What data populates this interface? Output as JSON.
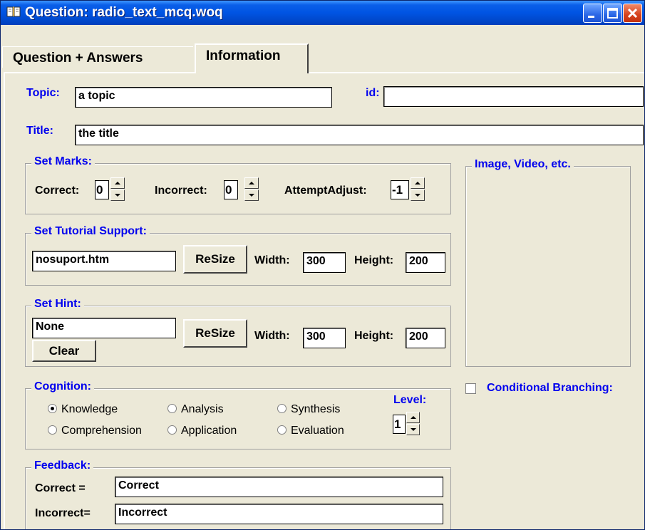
{
  "window": {
    "title": "Question: radio_text_mcq.woq",
    "controls": {
      "minimize": "minimize-icon",
      "maximize": "maximize-icon",
      "close": "close-icon"
    }
  },
  "tabs": [
    {
      "label": "Question + Answers",
      "active": false
    },
    {
      "label": "Information",
      "active": true
    }
  ],
  "info": {
    "topic_label": "Topic:",
    "topic_value": "a topic",
    "id_label": "id:",
    "id_value": "",
    "title_label": "Title:",
    "title_value": "the title"
  },
  "set_marks": {
    "legend": "Set Marks:",
    "correct_label": "Correct:",
    "correct_value": "0",
    "incorrect_label": "Incorrect:",
    "incorrect_value": "0",
    "attempt_label": "AttemptAdjust:",
    "attempt_value": "-1"
  },
  "tutorial": {
    "legend": "Set Tutorial Support:",
    "file": "nosuport.htm",
    "resize_label": "ReSize",
    "width_label": "Width:",
    "width_value": "300",
    "height_label": "Height:",
    "height_value": "200"
  },
  "hint": {
    "legend": "Set Hint:",
    "value": "None",
    "clear_label": "Clear",
    "resize_label": "ReSize",
    "width_label": "Width:",
    "width_value": "300",
    "height_label": "Height:",
    "height_value": "200"
  },
  "media": {
    "legend": "Image, Video, etc."
  },
  "cognition": {
    "legend": "Cognition:",
    "options": [
      "Knowledge",
      "Analysis",
      "Synthesis",
      "Comprehension",
      "Application",
      "Evaluation"
    ],
    "selected": "Knowledge",
    "level_label": "Level:",
    "level_value": "1"
  },
  "branching": {
    "label": "Conditional Branching:",
    "checked": false
  },
  "feedback": {
    "legend": "Feedback:",
    "correct_label": "Correct =",
    "correct_value": "Correct",
    "incorrect_label": "Incorrect=",
    "incorrect_value": "Incorrect"
  },
  "colors": {
    "title_bar": "#0054e3",
    "label_blue": "#0000ee",
    "face": "#ece9d8",
    "close_red": "#d5411c"
  }
}
